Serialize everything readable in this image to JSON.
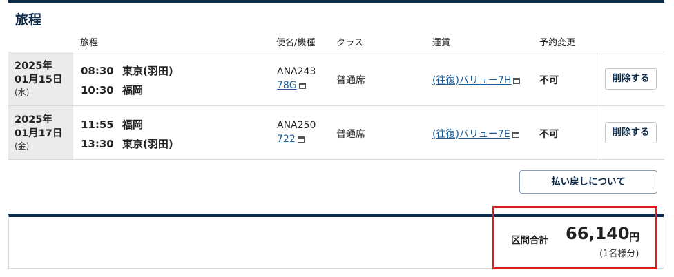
{
  "section": {
    "title": "旅程"
  },
  "columns": {
    "itinerary": "旅程",
    "flight_equipment": "便名/機種",
    "cabin": "クラス",
    "fare": "運賃",
    "change": "予約変更"
  },
  "rows": [
    {
      "year": "2025年",
      "month_day": "01月15日",
      "weekday": "(水)",
      "dep_time": "08:30",
      "dep_place": "東京(羽田)",
      "arr_time": "10:30",
      "arr_place": "福岡",
      "flight_no": "ANA243",
      "equipment": "78G",
      "cabin": "普通席",
      "fare": "(往復)バリュー7H",
      "change": "不可",
      "delete_label": "削除する"
    },
    {
      "year": "2025年",
      "month_day": "01月17日",
      "weekday": "(金)",
      "dep_time": "11:55",
      "dep_place": "福岡",
      "arr_time": "13:30",
      "arr_place": "東京(羽田)",
      "flight_no": "ANA250",
      "equipment": "722",
      "cabin": "普通席",
      "fare": "(往復)バリュー7E",
      "change": "不可",
      "delete_label": "削除する"
    }
  ],
  "refund_button": "払い戻しについて",
  "total": {
    "label": "区間合計",
    "amount": "66,140",
    "unit": "円",
    "note": "(1名様分)"
  },
  "colors": {
    "navy": "#0d2b4a",
    "link": "#1a5a96",
    "highlight": "#e11b22"
  },
  "icons": [
    "new-window-icon"
  ]
}
